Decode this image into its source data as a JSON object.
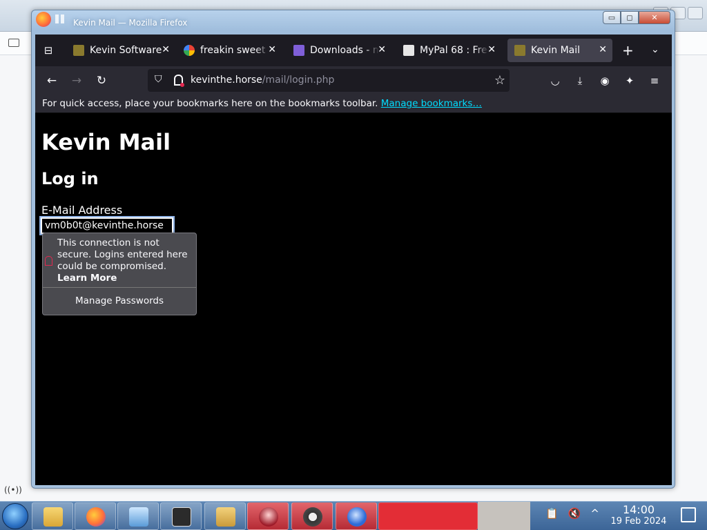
{
  "window": {
    "title": "Kevin Mail — Mozilla Firefox",
    "controls": [
      "▭",
      "◻",
      "✕"
    ]
  },
  "tabs": [
    {
      "title": "Kevin Software",
      "favicon_color": "#8a7a2e",
      "active": false
    },
    {
      "title": "freakin sweet -",
      "favicon_color": "#4285f4",
      "active": false
    },
    {
      "title": "Downloads - m",
      "favicon_color": "#7f5fd8",
      "active": false
    },
    {
      "title": "MyPal 68 : Free",
      "favicon_color": "#e6e6e6",
      "active": false
    },
    {
      "title": "Kevin Mail",
      "favicon_color": "#8a7a2e",
      "active": true
    }
  ],
  "icons": {
    "tab_overview": "⊟",
    "close": "✕",
    "new_tab": "+",
    "tab_list": "⌄",
    "back": "←",
    "forward": "→",
    "reload": "↻",
    "shield": "⛉",
    "star": "☆",
    "pocket": "◡",
    "download": "⤓",
    "account": "◉",
    "extensions": "✦",
    "menu": "≡"
  },
  "urlbar": {
    "domain": "kevinthe.horse",
    "path": "/mail/login.php"
  },
  "bookmarks_bar": {
    "message": "For quick access, place your bookmarks here on the bookmarks toolbar.",
    "link": "Manage bookmarks…"
  },
  "page": {
    "heading": "Kevin Mail",
    "subheading": "Log in",
    "email_label": "E-Mail Address",
    "email_value": "vm0b0t@kevinthe.horse"
  },
  "insecure_popup": {
    "message": "This connection is not secure. Logins entered here could be compromised.",
    "learn_more": "Learn More",
    "manage": "Manage Passwords"
  },
  "taskbar": {
    "time": "14:00",
    "date": "19 Feb 2024",
    "tray_icons": [
      "📋",
      "🔇",
      "^"
    ],
    "signal_icon": "((•))"
  }
}
